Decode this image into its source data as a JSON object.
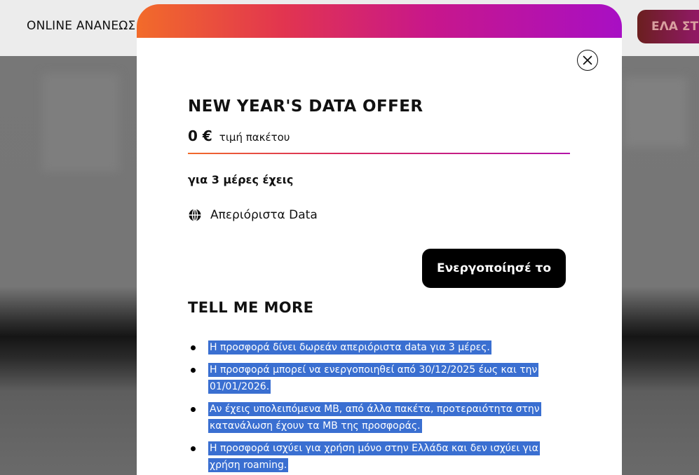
{
  "site": {
    "nav_link": "ONLINE ΑΝΑΝΕΩΣ",
    "cta_label": "ΕΛΑ ΣΤ"
  },
  "modal": {
    "title": "NEW YEAR'S DATA OFFER",
    "price_value": "0 €",
    "price_label": "τιμή πακέτου",
    "days_text": "για 3 μέρες έχεις",
    "feature_label": "Απεριόριστα Data",
    "activate_label": "Ενεργοποίησέ το",
    "more_title": "TELL ME MORE",
    "terms": [
      "Η προσφορά δίνει δωρεάν απεριόριστα data για 3 μέρες.",
      "Η προσφορά μπορεί να ενεργοποιηθεί από 30/12/2025 έως και την 01/01/2026.",
      "Αν έχεις υπολειπόμενα MB, από άλλα πακέτα, προτεραιότητα στην κατανάλωση έχουν τα MB της προσφοράς.",
      "Η προσφορά ισχύει για χρήση μόνο στην Ελλάδα και δεν ισχύει για χρήση roaming."
    ]
  },
  "colors": {
    "gradient_start": "#f26b2a",
    "gradient_end": "#a80fc4",
    "selection": "#3a6fd1",
    "button": "#000000"
  }
}
